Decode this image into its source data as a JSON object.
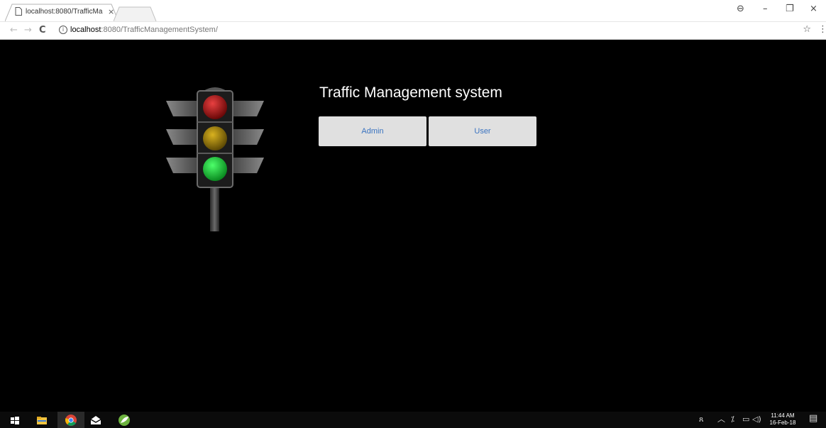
{
  "browser": {
    "tab_title": "localhost:8080/TrafficMa",
    "tab_close": "×",
    "url_host": "localhost",
    "url_path": ":8080/TrafficManagementSystem/",
    "back_glyph": "←",
    "forward_glyph": "→",
    "reload_glyph": "C",
    "info_glyph": "i",
    "star_glyph": "☆",
    "menu_glyph": "⋮",
    "profile_glyph": "⊖",
    "minimize_glyph": "–",
    "maximize_glyph": "❐",
    "close_glyph": "×"
  },
  "page": {
    "title": "Traffic Management system",
    "buttons": {
      "admin": "Admin",
      "user": "User"
    },
    "traffic_light_colors": {
      "red": "#c61818",
      "yellow": "#b8930d",
      "green": "#15d63a"
    },
    "button_text_color": "#3a73c0"
  },
  "taskbar": {
    "icons": [
      "windows-start-icon",
      "file-explorer-icon",
      "chrome-icon",
      "mail-icon",
      "spring-tool-icon"
    ],
    "tray_people": "ጸ",
    "tray_chevron": "︿",
    "tray_wifi": "⁒",
    "tray_battery": "▭",
    "tray_volume": "◁)",
    "time": "11:44 AM",
    "date": "16-Feb-18",
    "notification_glyph": "▤"
  }
}
